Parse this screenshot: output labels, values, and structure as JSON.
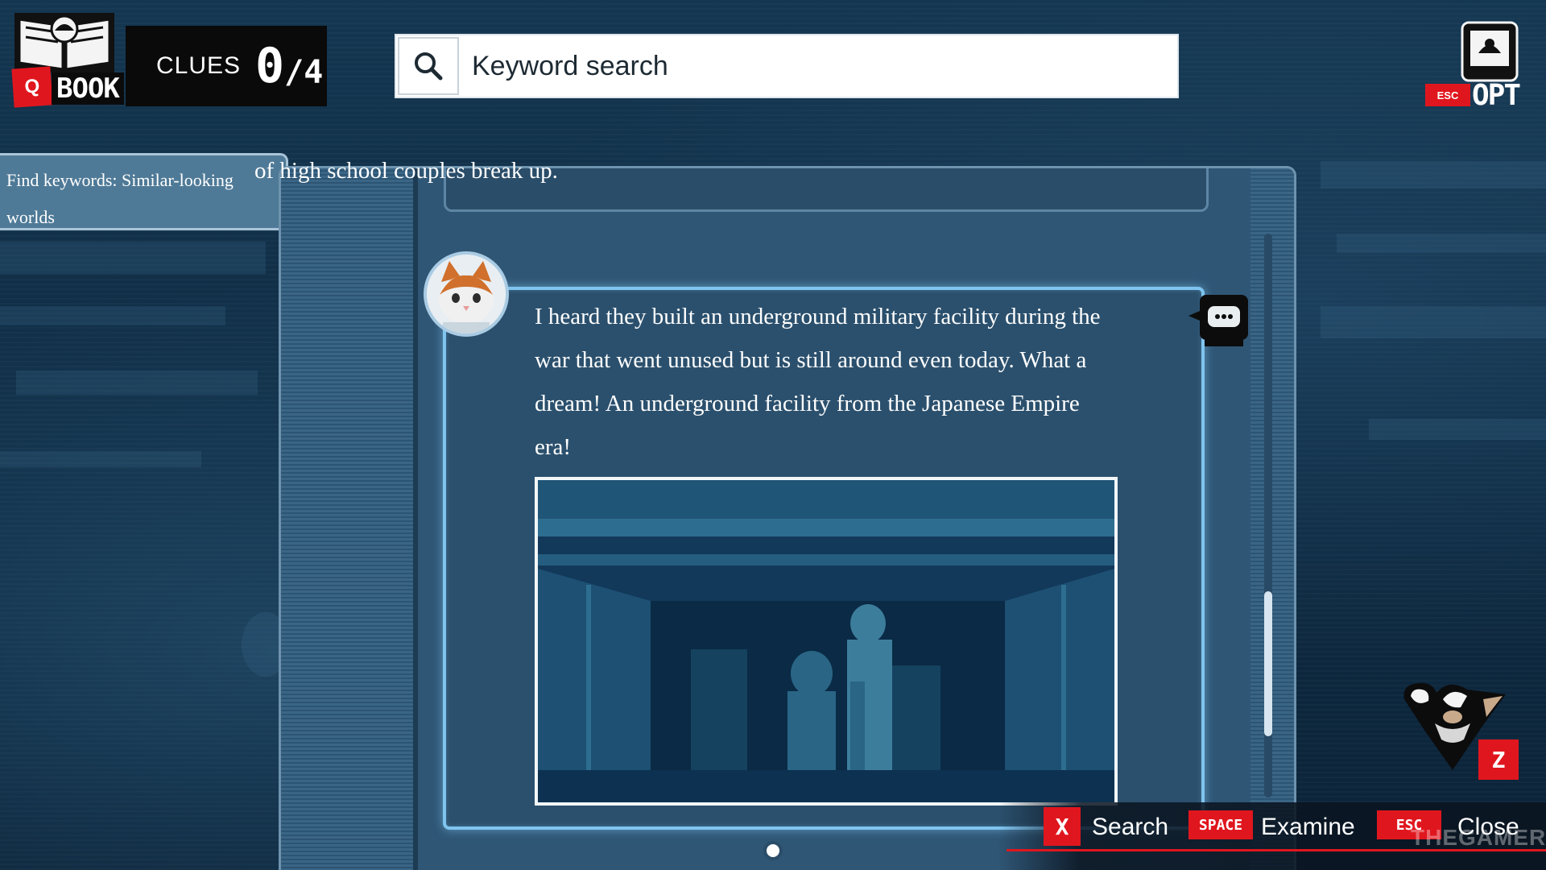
{
  "hud": {
    "book_key": "Q",
    "book_label": "BOOK",
    "clues_label": "CLUES",
    "clues_found": "0",
    "clues_total": "/4",
    "options_key": "ESC",
    "options_label": "OPT"
  },
  "search": {
    "placeholder": "Keyword search",
    "icon": "search-icon"
  },
  "objective": {
    "text": "Find keywords: Similar-looking worlds"
  },
  "feed": {
    "previous_post_tail": "of high school couples break up.",
    "current_post": {
      "avatar": "cat-avatar",
      "text": "I heard they built an underground military facility during the war that went unused but is still around even today. What a dream! An underground facility from the Japanese Empire era!",
      "comment_icon": "chat-bubble-icon",
      "image": "underground-facility-image"
    }
  },
  "scrollbar": {
    "position_fraction": 0.7
  },
  "actions": [
    {
      "key": "X",
      "label": "Search"
    },
    {
      "key": "SPACE",
      "label": "Examine"
    },
    {
      "key": "ESC",
      "label": "Close"
    }
  ],
  "partner": {
    "key": "Z",
    "icon": "partner-mascot-icon"
  },
  "watermark": "THEGAMER",
  "colors": {
    "accent_red": "#e0161e",
    "panel_blue": "#3b6585",
    "card_glow": "#7fc4ef",
    "background": "#0f2c44"
  }
}
